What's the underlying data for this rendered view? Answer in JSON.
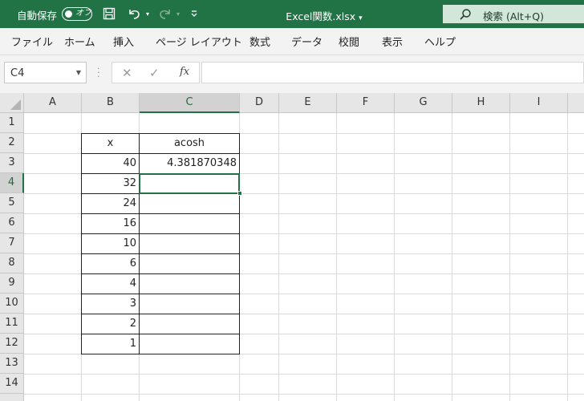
{
  "titlebar": {
    "autosave_label": "自動保存",
    "autosave_state": "オフ",
    "filename": "Excel関数.xlsx",
    "filename_caret": "▾",
    "search_text": "検索 (Alt+Q)",
    "accent_color": "#217346",
    "icons": [
      "save-icon",
      "undo-icon",
      "redo-icon",
      "customize-qat-icon",
      "search-icon"
    ]
  },
  "ribbon": {
    "tabs": [
      "ファイル",
      "ホーム",
      "挿入",
      "ページ レイアウト",
      "数式",
      "データ",
      "校閲",
      "表示",
      "ヘルプ"
    ]
  },
  "formula_bar": {
    "name_box": "C4",
    "fx_label": "fx",
    "formula_value": ""
  },
  "grid": {
    "columns": [
      "A",
      "B",
      "C",
      "D",
      "E",
      "F",
      "G",
      "H",
      "I"
    ],
    "rows": [
      "1",
      "2",
      "3",
      "4",
      "5",
      "6",
      "7",
      "8",
      "9",
      "10",
      "11",
      "12",
      "13",
      "14"
    ],
    "selected_cell": "C4",
    "table": {
      "header": [
        "x",
        "acosh"
      ],
      "rows": [
        [
          "40",
          "4.381870348"
        ],
        [
          "32",
          ""
        ],
        [
          "24",
          ""
        ],
        [
          "16",
          ""
        ],
        [
          "10",
          ""
        ],
        [
          "6",
          ""
        ],
        [
          "4",
          ""
        ],
        [
          "3",
          ""
        ],
        [
          "2",
          ""
        ],
        [
          "1",
          ""
        ]
      ]
    }
  }
}
